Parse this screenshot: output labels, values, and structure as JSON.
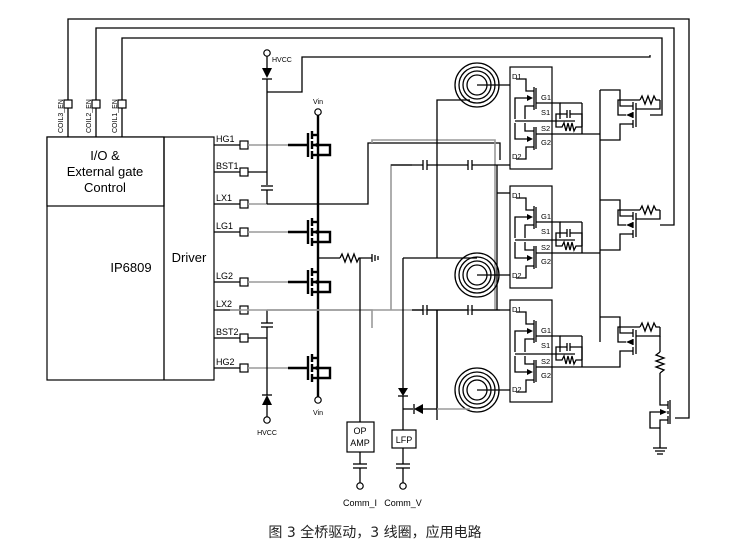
{
  "figure": {
    "caption": "图 3 全桥驱动，3 线圈，应用电路",
    "chip": {
      "name": "IP6809",
      "io_block": [
        "I/O &",
        "External gate",
        "Control"
      ],
      "driver_label": "Driver"
    },
    "enable_pins": [
      "COIL3_EN",
      "COIL2_EN",
      "COIL1_EN"
    ],
    "driver_pins": [
      "HG1",
      "BST1",
      "LX1",
      "LG1",
      "LG2",
      "LX2",
      "BST2",
      "HG2"
    ],
    "supply_labels": {
      "hvcc_top": "HVCC",
      "hvcc_bottom": "HVCC",
      "vin_top": "Vin",
      "vin_bottom": "Vin"
    },
    "blocks": {
      "op_amp": [
        "OP",
        "AMP"
      ],
      "lfp": "LFP"
    },
    "outputs": {
      "comm_i": "Comm_I",
      "comm_v": "Comm_V"
    },
    "switch_pin_labels": [
      "D1",
      "G1",
      "S1",
      "S2",
      "G2",
      "D2"
    ],
    "coil_count": 3
  }
}
